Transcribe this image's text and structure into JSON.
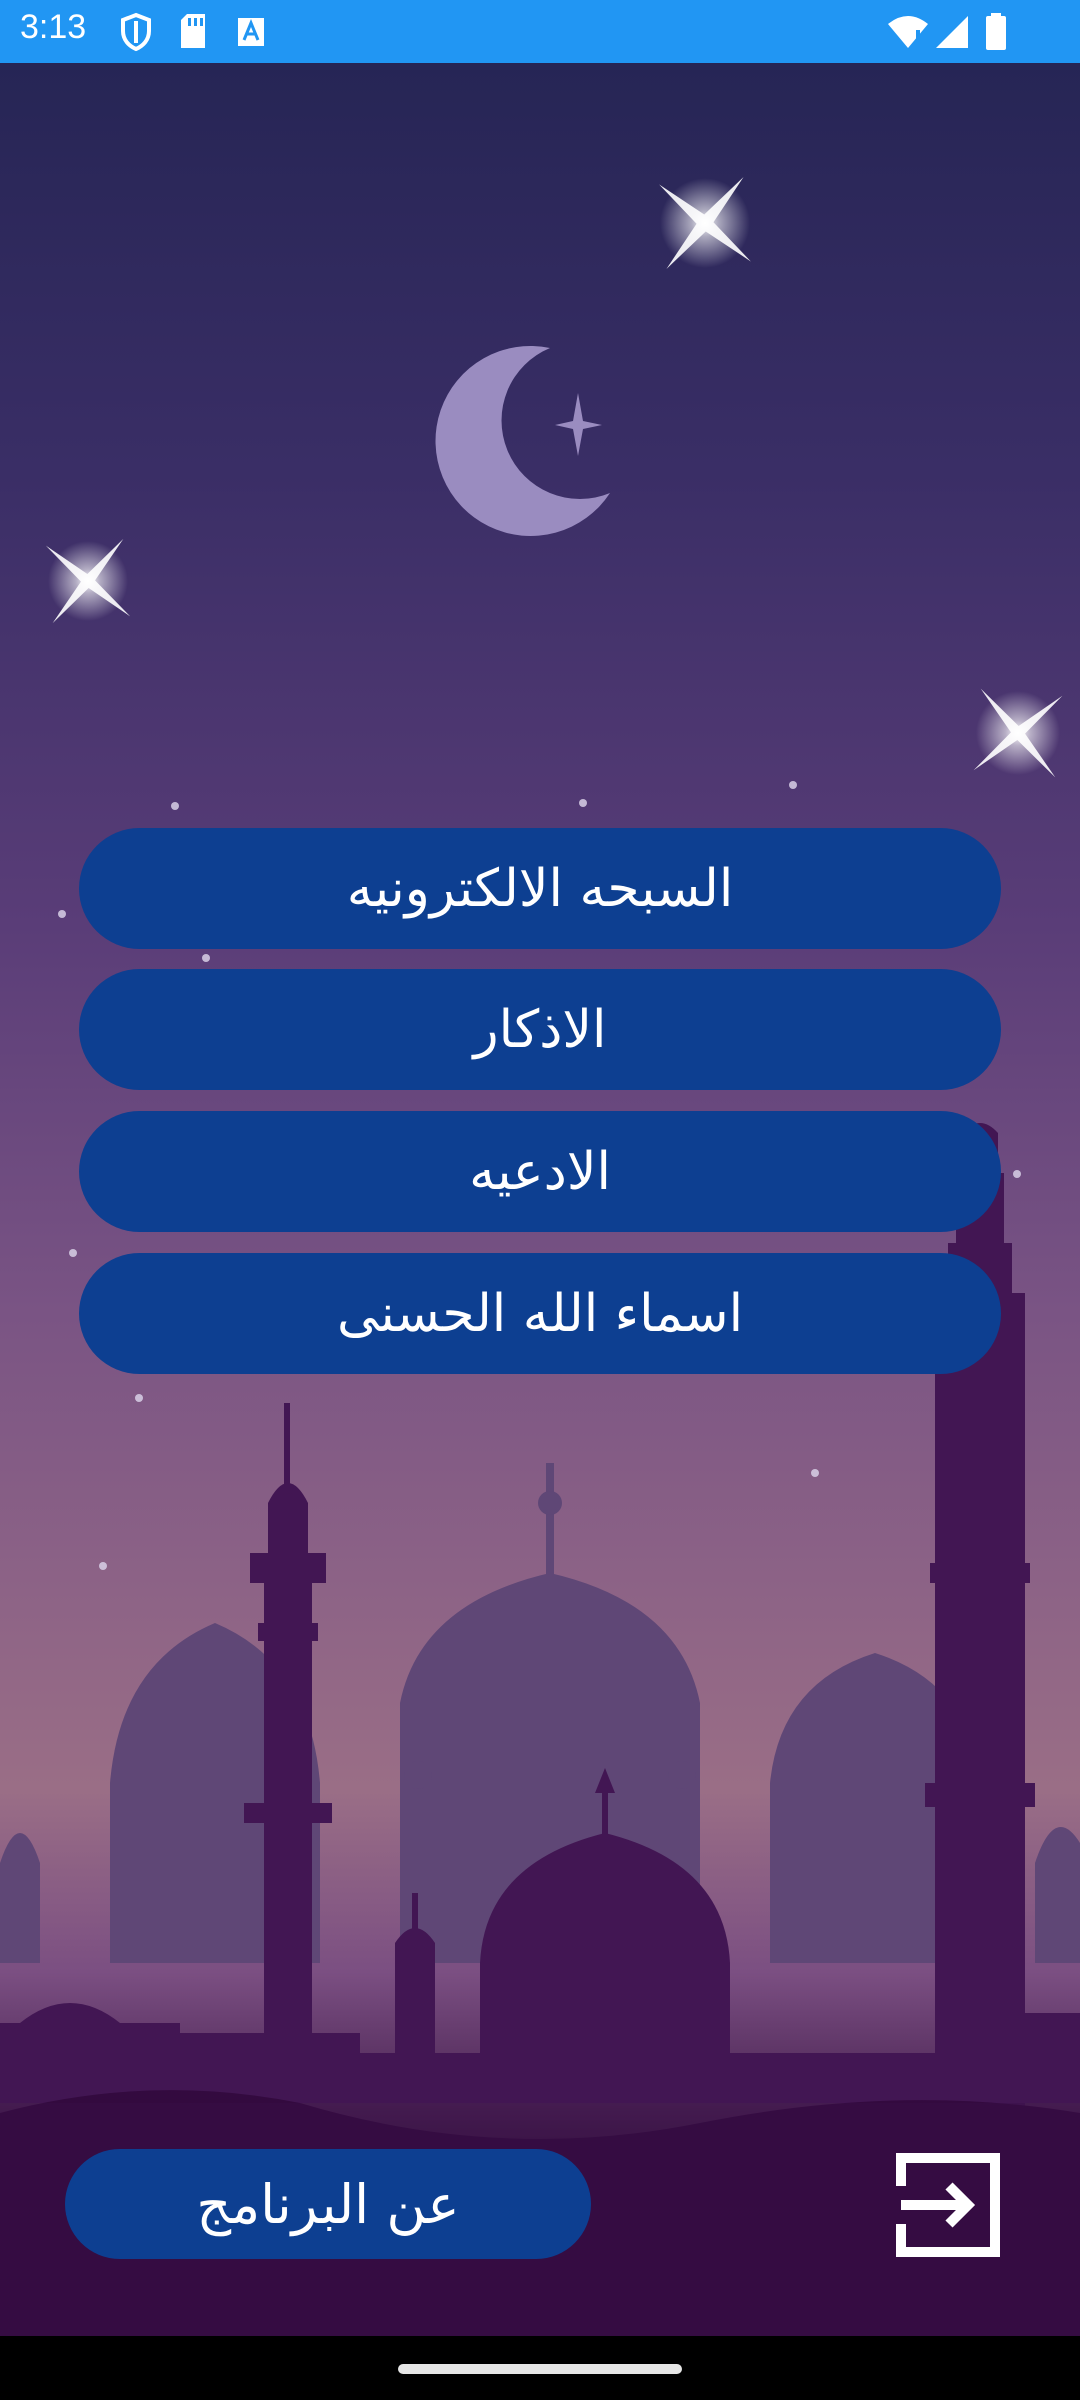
{
  "status_bar": {
    "time": "3:13",
    "left_icons": [
      "shield-icon",
      "sd-card-icon",
      "text-a-icon"
    ],
    "right_icons": [
      "wifi-icon",
      "signal-icon",
      "battery-icon"
    ],
    "color": "#2196F3"
  },
  "menu": {
    "items": [
      {
        "label": "السبحه الالكترونيه"
      },
      {
        "label": "الاذكار"
      },
      {
        "label": "الادعيه"
      },
      {
        "label": "اسماء الله الحسنى"
      }
    ],
    "button_color": "#0d3f91"
  },
  "footer": {
    "about_label": "عن البرنامج",
    "exit_icon": "exit-icon"
  }
}
